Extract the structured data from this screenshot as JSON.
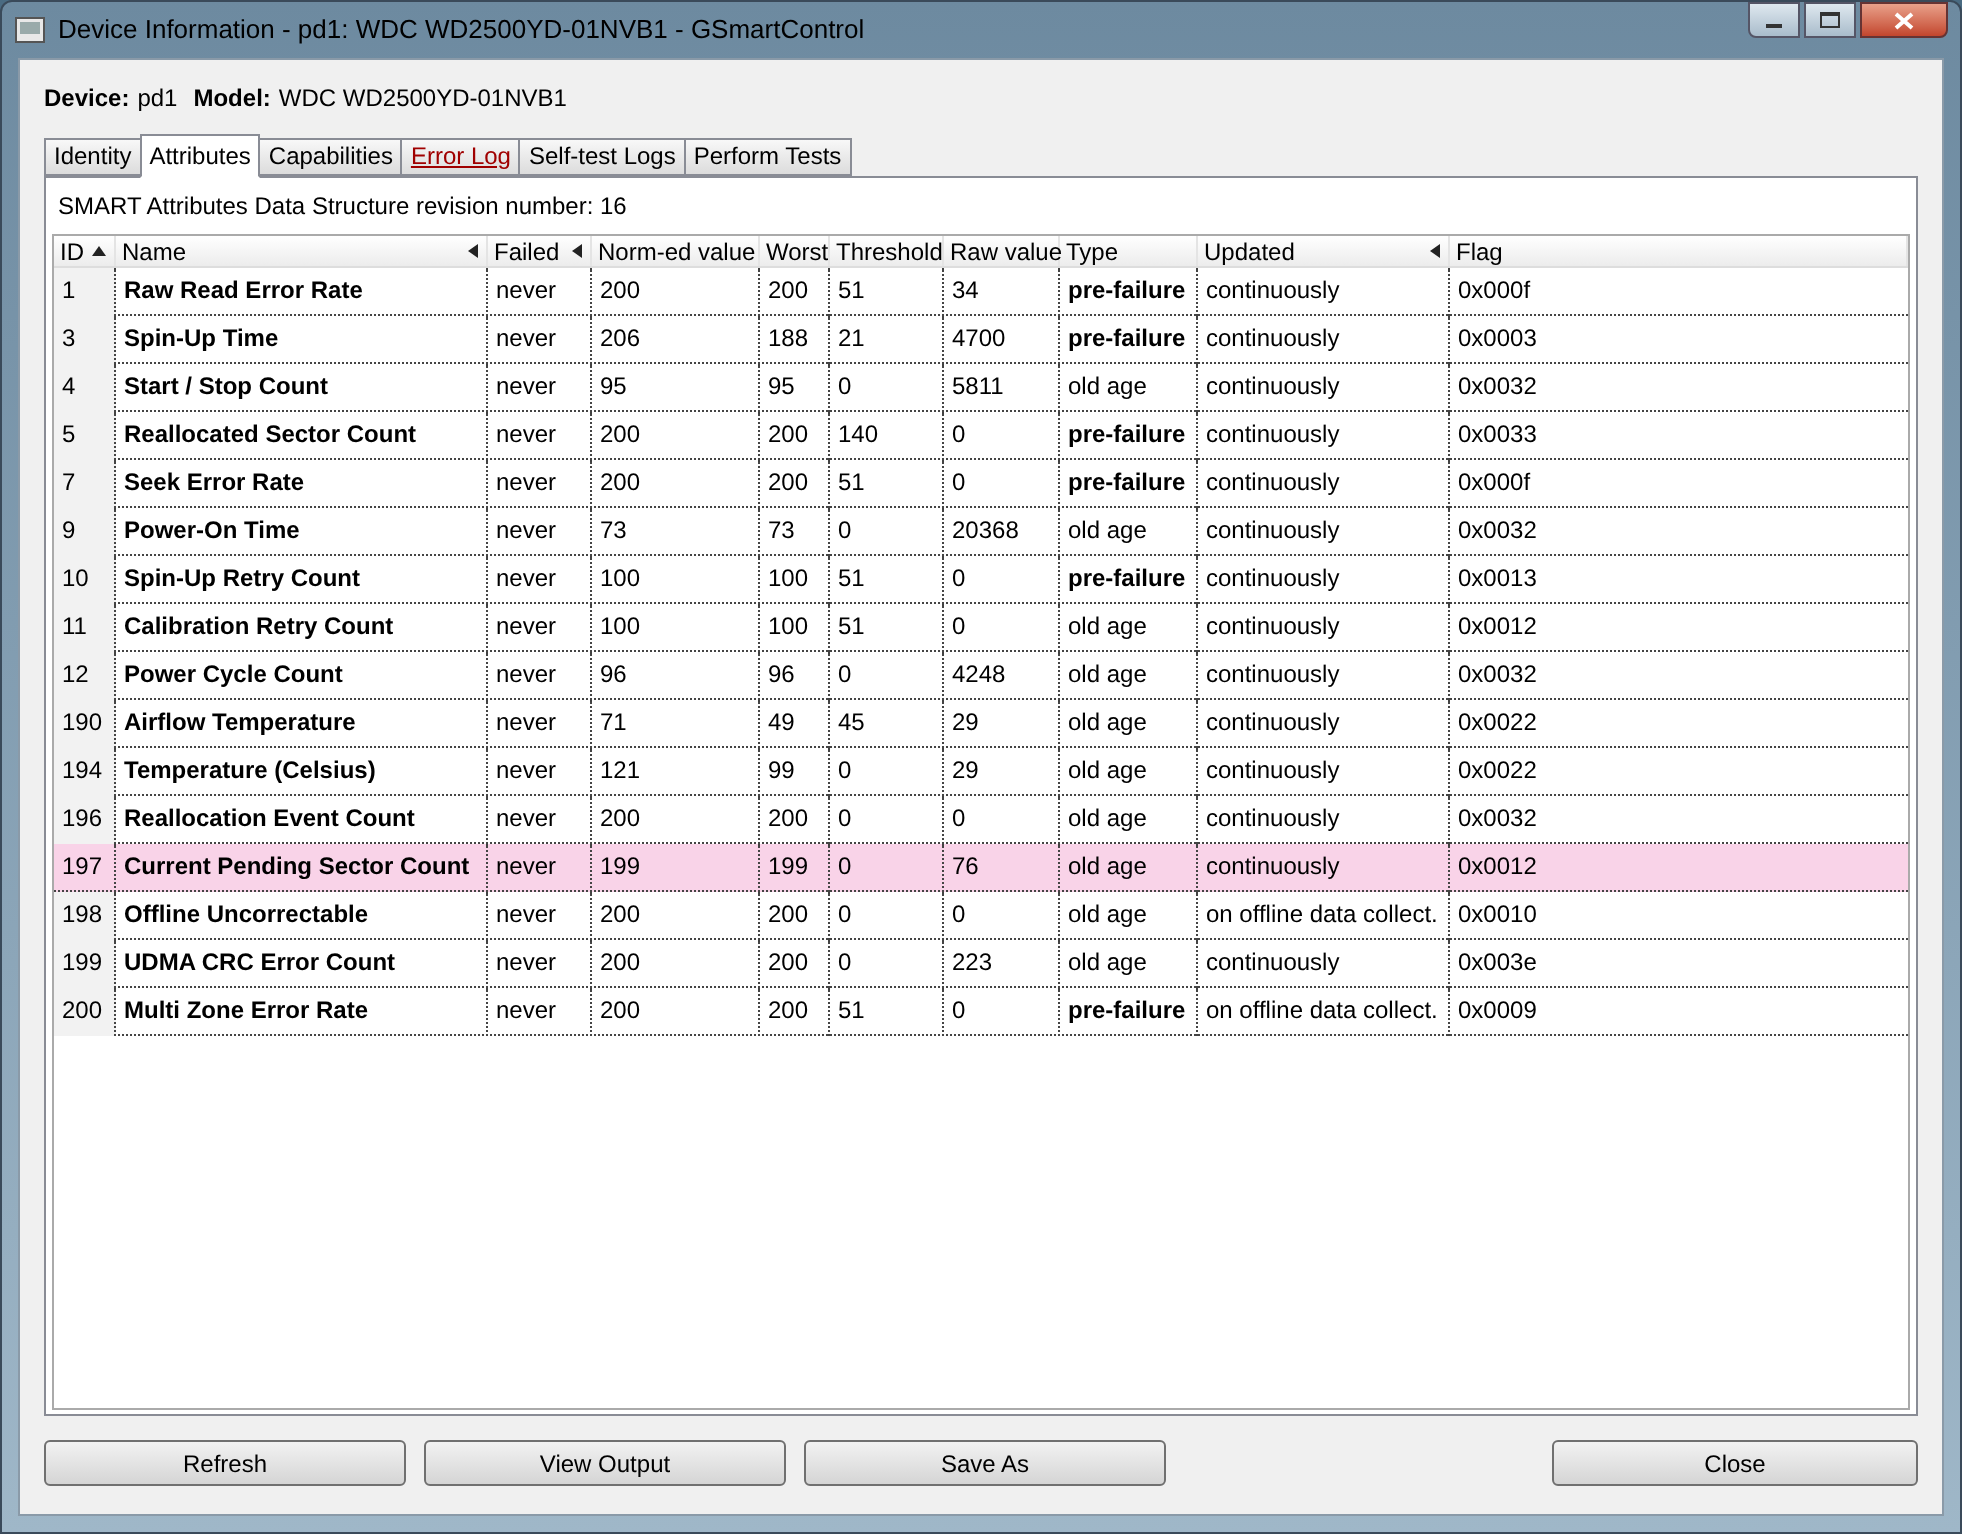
{
  "window": {
    "title": "Device Information - pd1: WDC WD2500YD-01NVB1 - GSmartControl"
  },
  "device": {
    "device_label": "Device:",
    "device": "pd1",
    "model_label": "Model:",
    "model": "WDC WD2500YD-01NVB1"
  },
  "tabs": [
    {
      "label": "Identity",
      "selected": false,
      "warning": false
    },
    {
      "label": "Attributes",
      "selected": true,
      "warning": false
    },
    {
      "label": "Capabilities",
      "selected": false,
      "warning": false
    },
    {
      "label": "Error Log",
      "selected": false,
      "warning": true
    },
    {
      "label": "Self-test Logs",
      "selected": false,
      "warning": false
    },
    {
      "label": "Perform Tests",
      "selected": false,
      "warning": false
    }
  ],
  "revision": "SMART Attributes Data Structure revision number: 16",
  "table": {
    "columns": [
      {
        "label": "ID",
        "sorted": true,
        "arrow": false
      },
      {
        "label": "Name",
        "sorted": false,
        "arrow": true
      },
      {
        "label": "Failed",
        "sorted": false,
        "arrow": true
      },
      {
        "label": "Norm-ed value",
        "sorted": false,
        "arrow": false
      },
      {
        "label": "Worst",
        "sorted": false,
        "arrow": false
      },
      {
        "label": "Threshold",
        "sorted": false,
        "arrow": false
      },
      {
        "label": "Raw value",
        "sorted": false,
        "arrow": false
      },
      {
        "label": "Type",
        "sorted": false,
        "arrow": false
      },
      {
        "label": "Updated",
        "sorted": false,
        "arrow": true
      },
      {
        "label": "Flag",
        "sorted": false,
        "arrow": false
      }
    ],
    "rows": [
      {
        "cells": [
          "1",
          "Raw Read Error Rate",
          "never",
          "200",
          "200",
          "51",
          "34",
          "pre-failure",
          "continuously",
          "0x000f"
        ],
        "prefailure": true,
        "highlighted": false
      },
      {
        "cells": [
          "3",
          "Spin-Up Time",
          "never",
          "206",
          "188",
          "21",
          "4700",
          "pre-failure",
          "continuously",
          "0x0003"
        ],
        "prefailure": true,
        "highlighted": false
      },
      {
        "cells": [
          "4",
          "Start / Stop Count",
          "never",
          "95",
          "95",
          "0",
          "5811",
          "old age",
          "continuously",
          "0x0032"
        ],
        "prefailure": false,
        "highlighted": false
      },
      {
        "cells": [
          "5",
          "Reallocated Sector Count",
          "never",
          "200",
          "200",
          "140",
          "0",
          "pre-failure",
          "continuously",
          "0x0033"
        ],
        "prefailure": true,
        "highlighted": false
      },
      {
        "cells": [
          "7",
          "Seek Error Rate",
          "never",
          "200",
          "200",
          "51",
          "0",
          "pre-failure",
          "continuously",
          "0x000f"
        ],
        "prefailure": true,
        "highlighted": false
      },
      {
        "cells": [
          "9",
          "Power-On Time",
          "never",
          "73",
          "73",
          "0",
          "20368",
          "old age",
          "continuously",
          "0x0032"
        ],
        "prefailure": false,
        "highlighted": false
      },
      {
        "cells": [
          "10",
          "Spin-Up Retry Count",
          "never",
          "100",
          "100",
          "51",
          "0",
          "pre-failure",
          "continuously",
          "0x0013"
        ],
        "prefailure": true,
        "highlighted": false
      },
      {
        "cells": [
          "11",
          "Calibration Retry Count",
          "never",
          "100",
          "100",
          "51",
          "0",
          "old age",
          "continuously",
          "0x0012"
        ],
        "prefailure": false,
        "highlighted": false
      },
      {
        "cells": [
          "12",
          "Power Cycle Count",
          "never",
          "96",
          "96",
          "0",
          "4248",
          "old age",
          "continuously",
          "0x0032"
        ],
        "prefailure": false,
        "highlighted": false
      },
      {
        "cells": [
          "190",
          "Airflow Temperature",
          "never",
          "71",
          "49",
          "45",
          "29",
          "old age",
          "continuously",
          "0x0022"
        ],
        "prefailure": false,
        "highlighted": false
      },
      {
        "cells": [
          "194",
          "Temperature (Celsius)",
          "never",
          "121",
          "99",
          "0",
          "29",
          "old age",
          "continuously",
          "0x0022"
        ],
        "prefailure": false,
        "highlighted": false
      },
      {
        "cells": [
          "196",
          "Reallocation Event Count",
          "never",
          "200",
          "200",
          "0",
          "0",
          "old age",
          "continuously",
          "0x0032"
        ],
        "prefailure": false,
        "highlighted": false
      },
      {
        "cells": [
          "197",
          "Current Pending Sector Count",
          "never",
          "199",
          "199",
          "0",
          "76",
          "old age",
          "continuously",
          "0x0012"
        ],
        "prefailure": false,
        "highlighted": true
      },
      {
        "cells": [
          "198",
          "Offline Uncorrectable",
          "never",
          "200",
          "200",
          "0",
          "0",
          "old age",
          "on offline data collect.",
          "0x0010"
        ],
        "prefailure": false,
        "highlighted": false
      },
      {
        "cells": [
          "199",
          "UDMA CRC Error Count",
          "never",
          "200",
          "200",
          "0",
          "223",
          "old age",
          "continuously",
          "0x003e"
        ],
        "prefailure": false,
        "highlighted": false
      },
      {
        "cells": [
          "200",
          "Multi Zone Error Rate",
          "never",
          "200",
          "200",
          "51",
          "0",
          "pre-failure",
          "on offline data collect.",
          "0x0009"
        ],
        "prefailure": true,
        "highlighted": false
      }
    ]
  },
  "buttons": [
    {
      "label": "Refresh"
    },
    {
      "label": "View Output"
    },
    {
      "label": "Save As"
    }
  ],
  "close_button": {
    "label": "Close"
  }
}
